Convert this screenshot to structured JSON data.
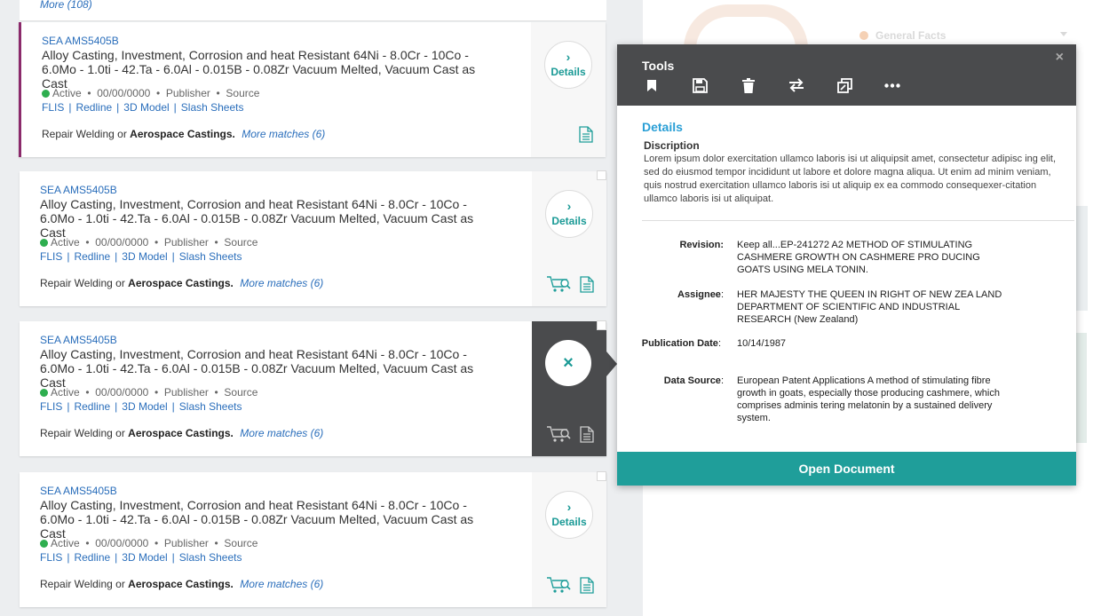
{
  "results": {
    "more_top": "More (108)",
    "cards": [
      {
        "code": "SEA AMS5405B",
        "title": "Alloy Casting, Investment, Corrosion and heat Resistant 64Ni - 8.0Cr - 10Co - 6.0Mo - 1.0ti - 42.Ta - 6.0Al - 0.015B - 0.08Zr Vacuum Melted, Vacuum Cast as Cast",
        "status": "Active",
        "date": "00/00/0000",
        "publisher": "Publisher",
        "source": "Source",
        "links": [
          "FLIS",
          "Redline",
          "3D Model",
          "Slash Sheets"
        ],
        "match_prefix": "Repair Welding or",
        "match_bold": "Aerospace Castings.",
        "more_matches": "More matches (6)",
        "details_label": "Details"
      },
      {
        "code": "SEA AMS5405B",
        "title": "Alloy Casting, Investment, Corrosion and heat Resistant 64Ni - 8.0Cr - 10Co - 6.0Mo - 1.0ti - 42.Ta - 6.0Al - 0.015B - 0.08Zr Vacuum Melted, Vacuum Cast as Cast",
        "status": "Active",
        "date": "00/00/0000",
        "publisher": "Publisher",
        "source": "Source",
        "links": [
          "FLIS",
          "Redline",
          "3D Model",
          "Slash Sheets"
        ],
        "match_prefix": "Repair Welding or",
        "match_bold": "Aerospace Castings.",
        "more_matches": "More matches (6)",
        "details_label": "Details"
      },
      {
        "code": "SEA AMS5405B",
        "title": "Alloy Casting, Investment, Corrosion and heat Resistant 64Ni - 8.0Cr - 10Co - 6.0Mo - 1.0ti - 42.Ta - 6.0Al - 0.015B - 0.08Zr Vacuum Melted, Vacuum Cast as Cast",
        "status": "Active",
        "date": "00/00/0000",
        "publisher": "Publisher",
        "source": "Source",
        "links": [
          "FLIS",
          "Redline",
          "3D Model",
          "Slash Sheets"
        ],
        "match_prefix": "Repair Welding or",
        "match_bold": "Aerospace Castings.",
        "more_matches": "More matches (6)",
        "close_label": "×"
      },
      {
        "code": "SEA AMS5405B",
        "title": "Alloy Casting, Investment, Corrosion and heat Resistant 64Ni - 8.0Cr - 10Co - 6.0Mo - 1.0ti - 42.Ta - 6.0Al - 0.015B - 0.08Zr Vacuum Melted, Vacuum Cast as Cast",
        "status": "Active",
        "date": "00/00/0000",
        "publisher": "Publisher",
        "source": "Source",
        "links": [
          "FLIS",
          "Redline",
          "3D Model",
          "Slash Sheets"
        ],
        "match_prefix": "Repair Welding or",
        "match_bold": "Aerospace Castings.",
        "more_matches": "More matches (6)",
        "details_label": "Details"
      }
    ],
    "separator": "•",
    "link_separator": "|"
  },
  "background": {
    "general_facts": "General Facts"
  },
  "popup": {
    "tools_title": "Tools",
    "close": "×",
    "tool_icons": [
      "bookmark-icon",
      "save-icon",
      "trash-icon",
      "swap-icon",
      "copy-icon",
      "more-icon"
    ],
    "details_heading": "Details",
    "description_label": "Discription",
    "description_text": "Lorem ipsum dolor exercitation ullamco laboris isi ut aliquipsit amet, consectetur adipisc ing elit, sed do eiusmod tempor incididunt ut labore et dolore magna aliqua. Ut enim ad minim veniam, quis nostrud exercitation ullamco laboris isi ut aliquip ex ea commodo consequexer-citation ullamco laboris isi ut aliquipat.",
    "fields": [
      {
        "key": "Revision",
        "value": "Keep all...EP-241272 A2 METHOD OF STIMULATING CASHMERE GROWTH ON CASHMERE PRO DUCING GOATS USING MELA TONIN."
      },
      {
        "key": "Assignee",
        "value": "HER MAJESTY THE QUEEN IN RIGHT OF NEW ZEA LAND DEPARTMENT OF SCIENTIFIC AND INDUSTRIAL RESEARCH (New Zealand)"
      },
      {
        "key": "Publication Date",
        "value": "10/14/1987"
      },
      {
        "key": "Data Source",
        "value": "European Patent Applications A method of stimulating fibre growth in goats, especially those producing cashmere, which comprises adminis tering melatonin by a sustained delivery system."
      }
    ],
    "open_button": "Open Document"
  },
  "colors": {
    "teal": "#1f9e9a",
    "link_blue": "#2a6ebb",
    "details_blue": "#2a9fd6",
    "dark_panel": "#4a4b4d",
    "active_green": "#2eae4f",
    "selected_border": "#8b2a6b"
  }
}
